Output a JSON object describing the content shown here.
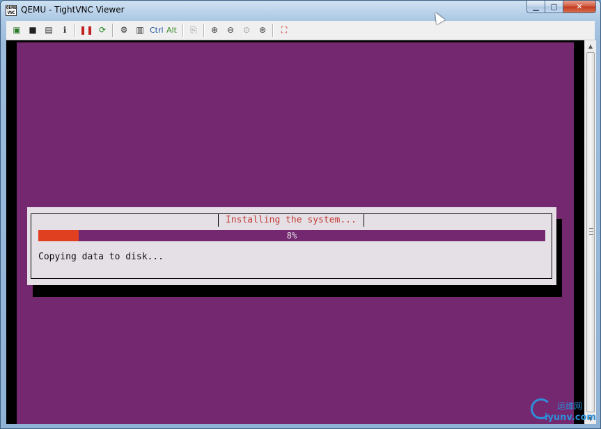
{
  "window": {
    "title": "QEMU - TightVNC Viewer",
    "app_icon_text_top": "QEMU",
    "app_icon_text_bottom": "VNC",
    "minimize_glyph": "▁",
    "maximize_glyph": "▢",
    "close_glyph": "✕"
  },
  "toolbar": {
    "buttons": [
      {
        "name": "new-connection-icon",
        "glyph": "▣",
        "color": "#2b7a2b"
      },
      {
        "name": "save-icon",
        "glyph": "■",
        "color": "#222222"
      },
      {
        "name": "options-icon",
        "glyph": "▤",
        "color": "#333333"
      },
      {
        "name": "connection-info-icon",
        "glyph": "ℹ",
        "color": "#333333"
      },
      {
        "name": "pause-icon",
        "glyph": "❚❚",
        "color": "#c0201f"
      },
      {
        "name": "refresh-icon",
        "glyph": "⟳",
        "color": "#2b8a2b"
      },
      {
        "name": "ctrl-alt-del-icon",
        "glyph": "⚙",
        "color": "#333333"
      },
      {
        "name": "send-keys-icon",
        "glyph": "▥",
        "color": "#333333"
      },
      {
        "name": "clipboard-icon",
        "glyph": "⎘",
        "color": "#9a9a9a"
      },
      {
        "name": "zoom-in-icon",
        "glyph": "⊕",
        "color": "#333333"
      },
      {
        "name": "zoom-out-icon",
        "glyph": "⊖",
        "color": "#333333"
      },
      {
        "name": "zoom-100-icon",
        "glyph": "⊙",
        "color": "#9a9a9a"
      },
      {
        "name": "zoom-fit-icon",
        "glyph": "⊛",
        "color": "#333333"
      },
      {
        "name": "fullscreen-icon",
        "glyph": "⛶",
        "color": "#c0201f"
      }
    ],
    "ctrl_label": "Ctrl",
    "alt_label": "Alt"
  },
  "installer": {
    "dialog_title": "Installing the system...",
    "progress_percent": 8,
    "progress_label": "8%",
    "status_text": "Copying data to disk..."
  },
  "scrollbar": {
    "up_glyph": "▲",
    "down_glyph": "▼"
  },
  "watermark": {
    "cn": "运维网",
    "en": "iyunv.com"
  },
  "colors": {
    "screen_bg": "#732870",
    "dialog_bg": "#e5e0e5",
    "dialog_title": "#c43b35",
    "progress_fill": "#e0401f"
  }
}
